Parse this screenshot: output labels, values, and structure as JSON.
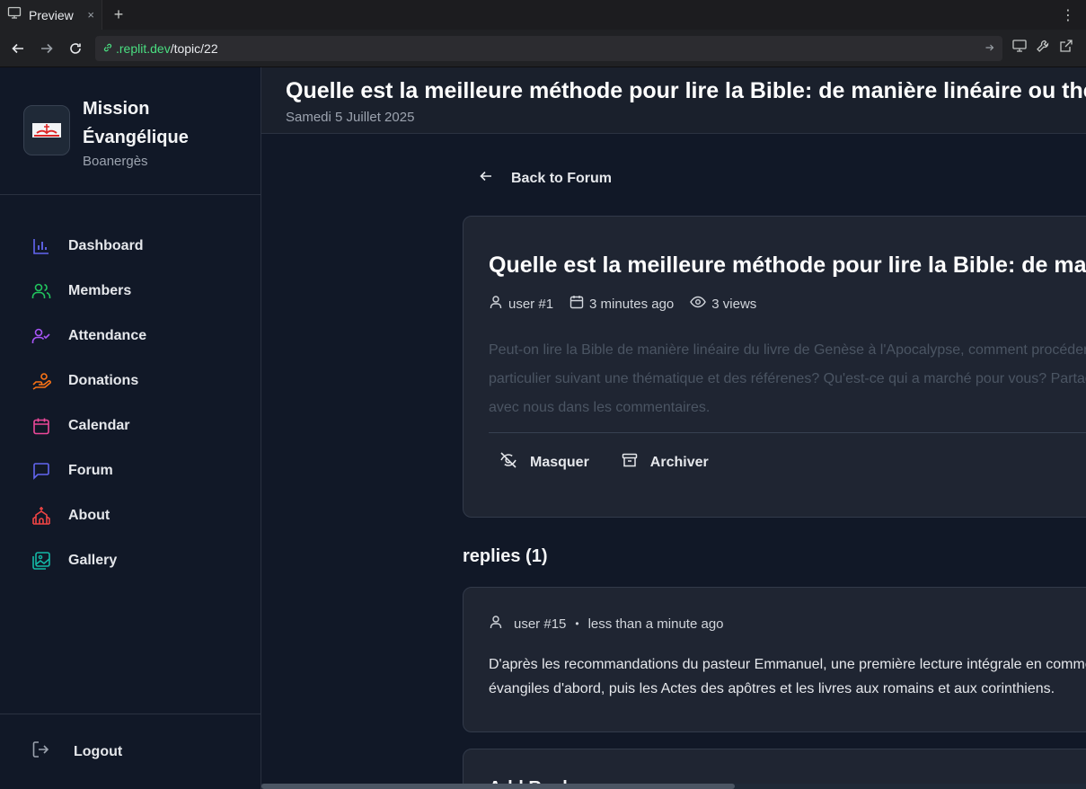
{
  "browser": {
    "tab_title": "Preview",
    "tab_close": "×",
    "new_tab": "+",
    "menu": "⋮",
    "url_host": ".replit.dev",
    "url_path": "/topic/22"
  },
  "sidebar": {
    "brand_name": "Mission Évangélique",
    "brand_sub": "Boanergès",
    "items": [
      {
        "label": "Dashboard",
        "icon": "bar-chart-icon",
        "color": "#6366f1"
      },
      {
        "label": "Members",
        "icon": "users-icon",
        "color": "#22c55e"
      },
      {
        "label": "Attendance",
        "icon": "user-check-icon",
        "color": "#a855f7"
      },
      {
        "label": "Donations",
        "icon": "hand-coins-icon",
        "color": "#f97316"
      },
      {
        "label": "Calendar",
        "icon": "calendar-icon",
        "color": "#ec4899"
      },
      {
        "label": "Forum",
        "icon": "message-square-icon",
        "color": "#6366f1"
      },
      {
        "label": "About",
        "icon": "church-icon",
        "color": "#ef4444"
      },
      {
        "label": "Gallery",
        "icon": "images-icon",
        "color": "#14b8a6"
      }
    ],
    "logout": "Logout"
  },
  "header": {
    "title": "Quelle est la meilleure méthode pour lire la Bible: de manière linéaire ou thématique?",
    "date": "Samedi 5 Juillet 2025"
  },
  "back": {
    "label": "Back to Forum"
  },
  "topic": {
    "title": "Quelle est la meilleure méthode pour lire la Bible: de manière linéaire ou thématique?",
    "author": "user #1",
    "time": "3 minutes ago",
    "views": "3 views",
    "body_line1": "Peut-on lire la Bible de manière linéaire du livre de Genèse à l'Apocalypse, comment procéder",
    "body_line2": "particulier suivant une thématique et des référenes? Qu'est-ce qui a marché pour vous? Partagez",
    "body_line3": "avec nous dans les commentaires.",
    "hide_label": "Masquer",
    "archive_label": "Archiver"
  },
  "replies": {
    "heading": "replies (1)",
    "items": [
      {
        "author": "user #15",
        "sep": "•",
        "time": "less than a minute ago",
        "line1": "D'après les recommandations du pasteur Emmanuel, une première lecture intégrale en commençant par les",
        "line2": "évangiles d'abord, puis les Actes des apôtres et les livres aux romains et aux corinthiens."
      }
    ]
  },
  "add_reply": {
    "title": "Add Reply"
  },
  "colors": {
    "accent_green": "#4ade80",
    "background": "#111827",
    "card": "#1f2532"
  }
}
